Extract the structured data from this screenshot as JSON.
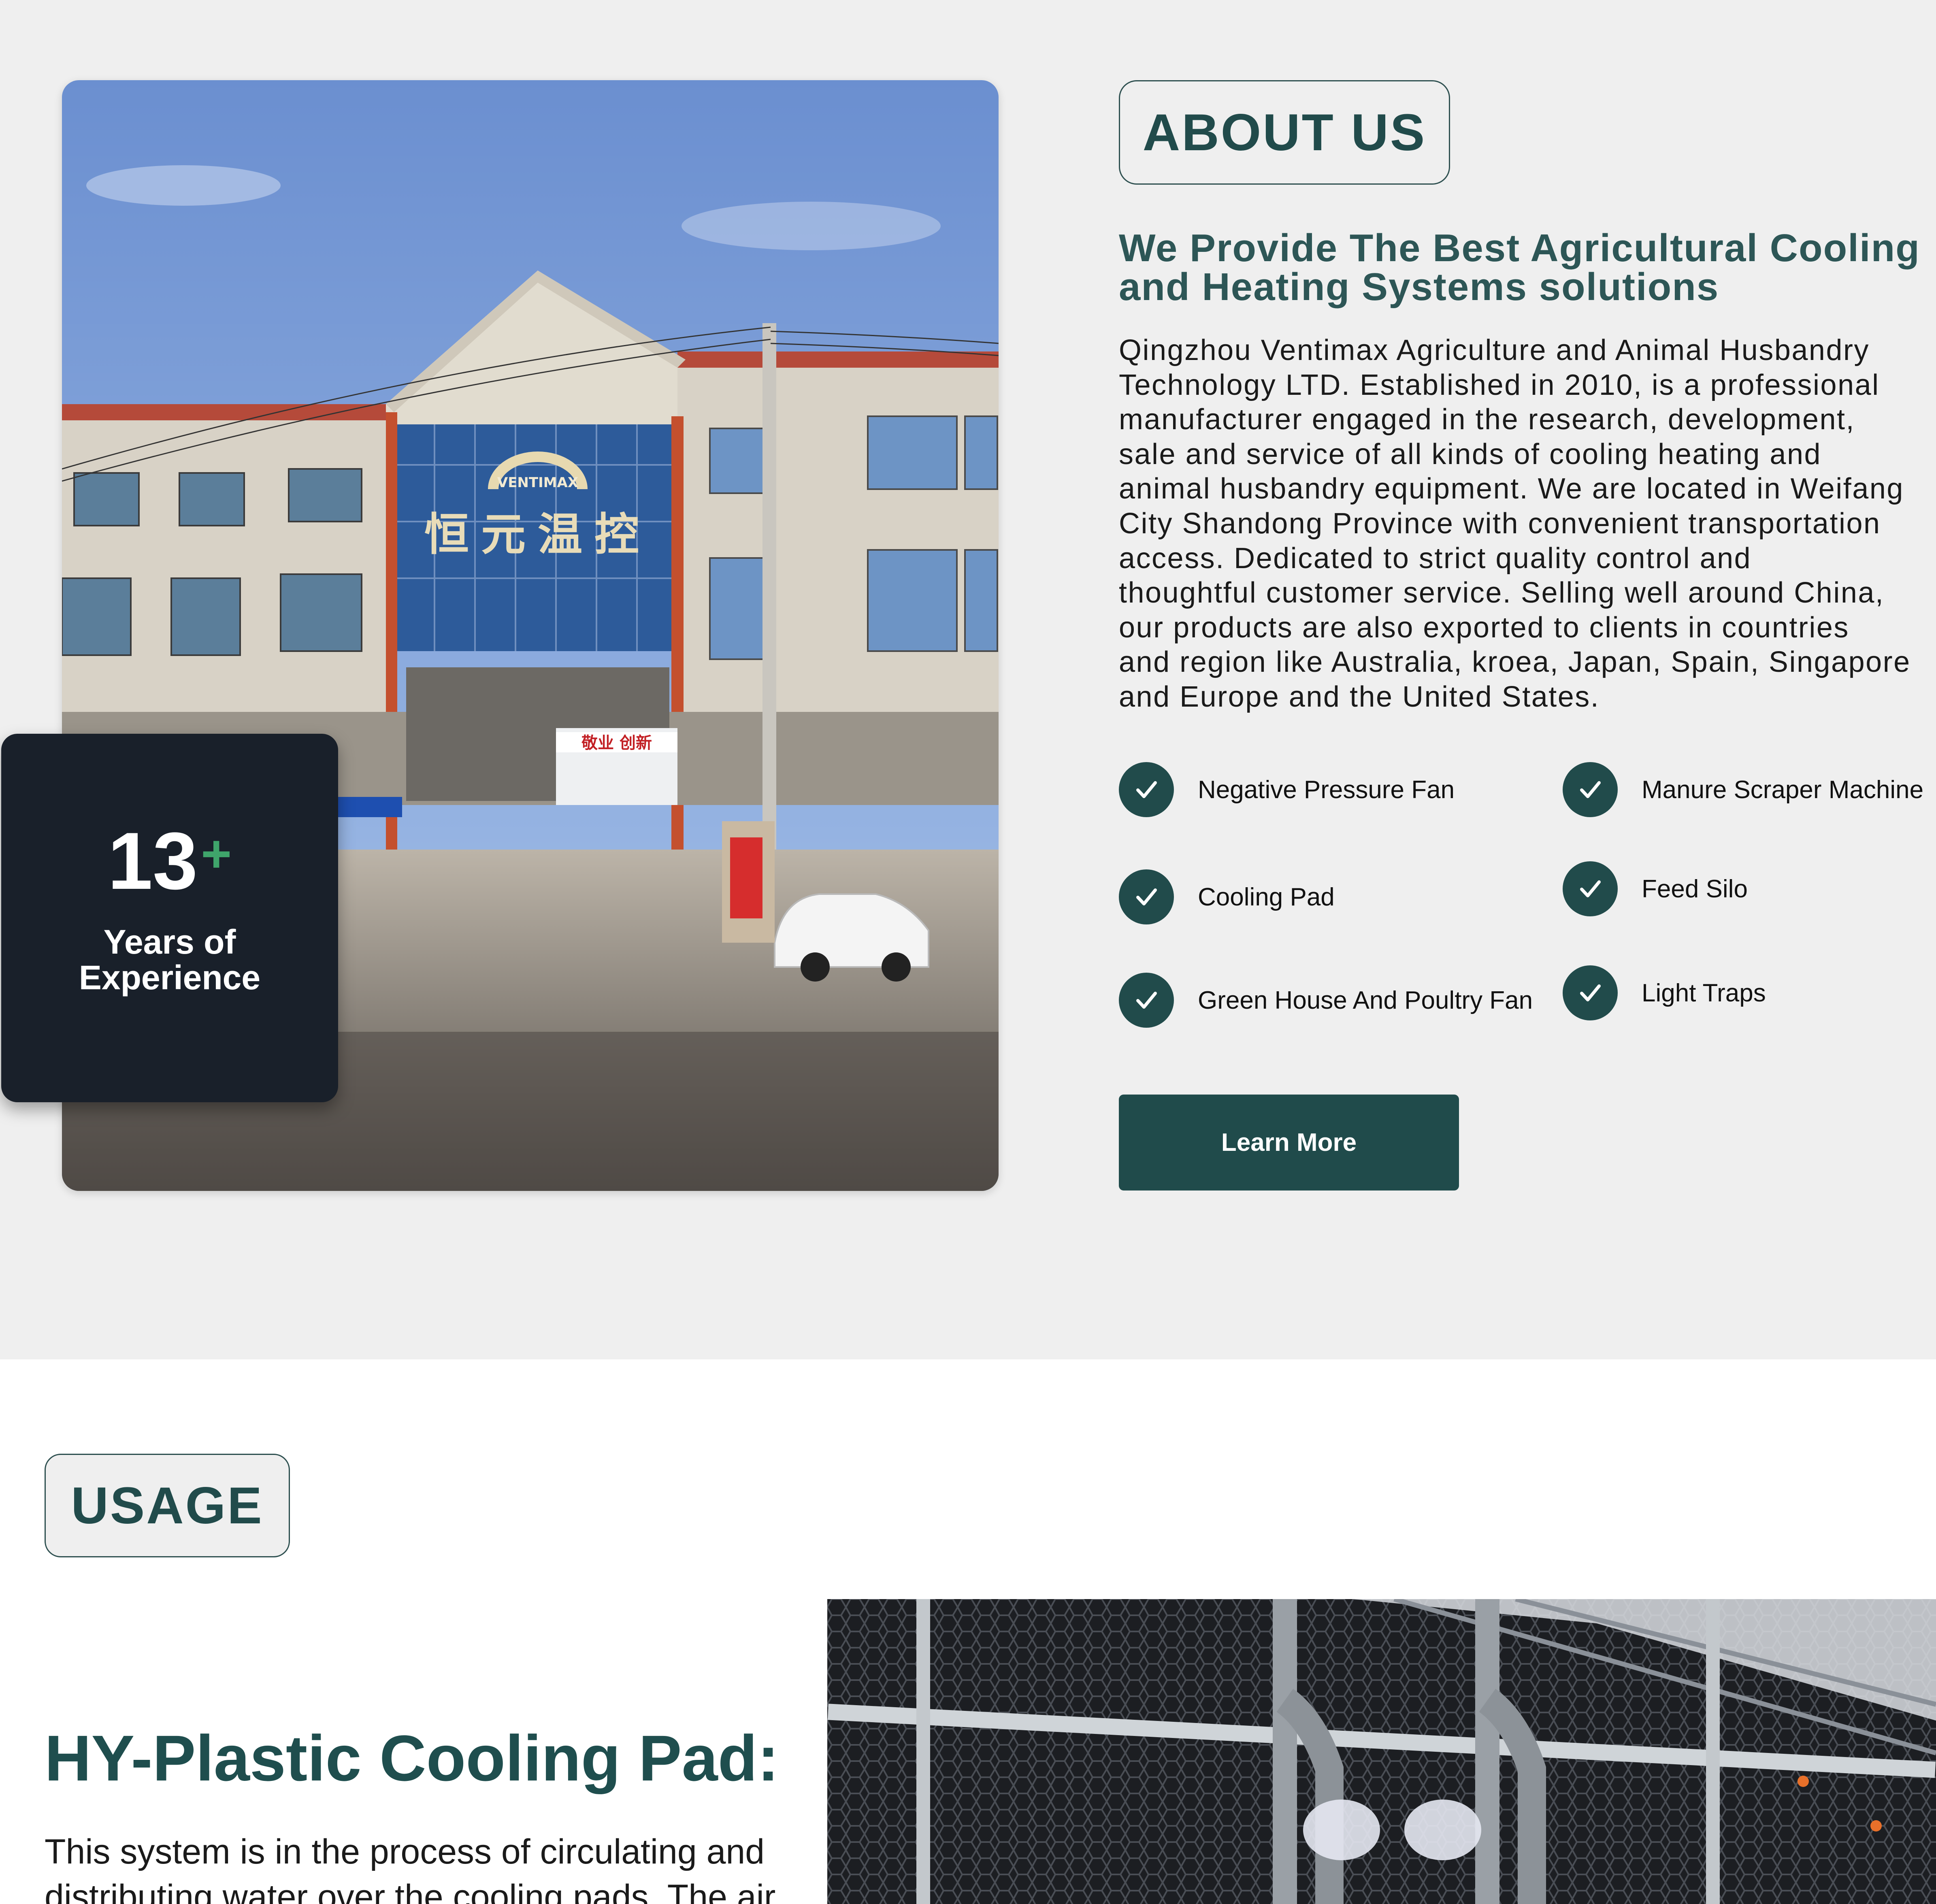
{
  "about": {
    "tag": "ABOUT US",
    "heading": "We Provide The Best Agricultural Cooling\nand Heating Systems solutions",
    "description": "Qingzhou Ventimax Agriculture and Animal Husbandry\nTechnology LTD. Established in 2010, is a professional\nmanufacturer engaged in the research, development,\nsale and service of all kinds of cooling heating and\nanimal husbandry equipment. We are located in Weifang\nCity Shandong Province with convenient transportation\naccess. Dedicated to strict quality control and\nthoughtful customer service. Selling well around China,\nour products are also exported to clients in countries\nand region like Australia, kroea, Japan, Spain, Singapore\nand Europe and the United States.",
    "photo": {
      "sign_text": "恒元温控",
      "logo_text": "VENTIMAX",
      "banner_text": "敬业 创新"
    },
    "experience": {
      "number": "13",
      "plus": "+",
      "label": "Years of Experience"
    },
    "features": [
      {
        "label": "Negative Pressure Fan",
        "icon": "check-icon"
      },
      {
        "label": "Cooling Pad",
        "icon": "check-icon"
      },
      {
        "label": "Green House And Poultry Fan",
        "icon": "check-icon"
      },
      {
        "label": "Manure Scraper Machine",
        "icon": "check-icon"
      },
      {
        "label": "Feed Silo",
        "icon": "check-icon"
      },
      {
        "label": "Light Traps",
        "icon": "check-icon"
      }
    ],
    "button_label": "Learn More"
  },
  "usage": {
    "tag": "USAGE",
    "heading": "HY-Plastic Cooling Pad:",
    "text": "This system is in the process of circulating and distributing water over the cooling pads. The air"
  },
  "colors": {
    "accent": "#204b4b",
    "heading": "#2d5656",
    "card": "#19202a",
    "plus": "#3fa56b",
    "section_bg": "#efefef"
  }
}
